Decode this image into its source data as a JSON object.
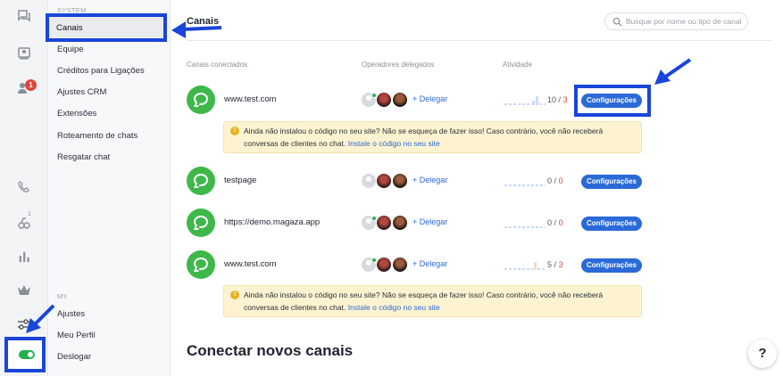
{
  "rail": {
    "icons": [
      "chat-icon",
      "inbox-icon",
      "users-icon",
      "phone-icon",
      "bot-icon",
      "stats-icon",
      "crown-icon",
      "sliders-icon"
    ],
    "users_badge": "1",
    "bot_sup": "1",
    "toggle_state": "on"
  },
  "sidebar": {
    "system_label": "SYSTEM",
    "system_items": [
      "Canais",
      "Equipe",
      "Créditos para Ligações",
      "Ajustes CRM",
      "Extensões",
      "Roteamento de chats",
      "Resgatar chat"
    ],
    "active_item": "Canais",
    "my_label": "MY",
    "my_items": [
      "Ajustes",
      "Meu Perfil",
      "Deslogar"
    ]
  },
  "header": {
    "title": "Canais",
    "search_placeholder": "Busque por nome ou tipo de canal"
  },
  "columns": {
    "connected": "Canais conectados",
    "operators": "Operadores delegados",
    "activity": "Atividade"
  },
  "channels": [
    {
      "name": "www.test.com",
      "delegate": "+ Delegar",
      "activity_current": "10",
      "activity_sep": "/",
      "activity_total": "3",
      "button": "Configurações"
    },
    {
      "name": "testpage",
      "delegate": "+ Delegar",
      "activity_current": "0",
      "activity_sep": "/",
      "activity_total": "0",
      "button": "Configurações"
    },
    {
      "name": "https://demo.magaza.app",
      "delegate": "+ Delegar",
      "activity_current": "0",
      "activity_sep": "/",
      "activity_total": "0",
      "button": "Configurações"
    },
    {
      "name": "www.test.com",
      "delegate": "+ Delegar",
      "activity_current": "5",
      "activity_sep": "/",
      "activity_total": "3",
      "button": "Configurações"
    }
  ],
  "warning": {
    "icon": "!",
    "text": "Ainda não instalou o código no seu site? Não se esqueça de fazer isso! Caso contrário, você não receberá conversas de clientes no chat.",
    "link": "Instale o código no seu site"
  },
  "new_section": {
    "title": "Conectar novos canais"
  },
  "help": {
    "label": "?"
  },
  "colors": {
    "accent": "#2a6ad8",
    "highlight": "#1a45d9",
    "channel_green": "#3fb84a",
    "warning_bg": "#fdf3d1",
    "error_red": "#d8453a"
  }
}
